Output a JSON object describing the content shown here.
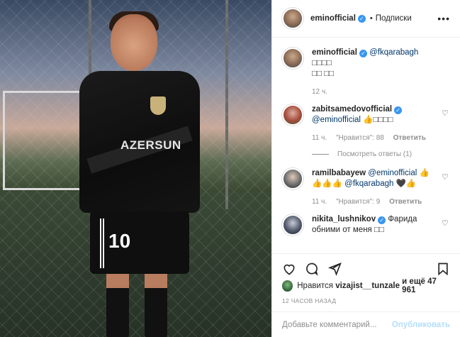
{
  "post": {
    "username": "eminofficial",
    "follow_label": "Подписки",
    "more_icon": "ellipsis-icon"
  },
  "photo": {
    "sponsor": "AZERSUN",
    "number": "10"
  },
  "caption": {
    "username": "eminofficial",
    "mention": "@fkqarabagh",
    "text_line1": "□□□□",
    "text_line2": "□□ □□",
    "time": "12 ч."
  },
  "comments": [
    {
      "username": "zabitsamedovofficial",
      "mention": "@eminofficial",
      "text": "👍□□□□",
      "time": "11 ч.",
      "likes": "\"Нравится\": 88",
      "reply": "Ответить"
    },
    {
      "username": "ramilbabayew",
      "mention": "@eminofficial",
      "text_pre": "👍",
      "text_line2_pre": "👍👍👍",
      "mention2": "@fkqarabagh",
      "text_line2_post": "🖤👍",
      "time": "11 ч.",
      "likes": "\"Нравится\": 9",
      "reply": "Ответить"
    },
    {
      "username": "nikita_lushnikov",
      "text": "Фарида",
      "text_line2": "обними от меня □□"
    }
  ],
  "view_replies": "Посмотреть ответы (1)",
  "likes": {
    "prefix": "Нравится",
    "user": "vizajist__tunzale",
    "suffix": "и ещё 47 961"
  },
  "timestamp": "12 ЧАСОВ НАЗАД",
  "comment_input": {
    "placeholder": "Добавьте комментарий...",
    "post_label": "Опубликовать"
  },
  "colors": {
    "link": "#00376b",
    "verified": "#3897f0",
    "muted": "#8e8e8e",
    "post_button": "#b2dffc"
  }
}
